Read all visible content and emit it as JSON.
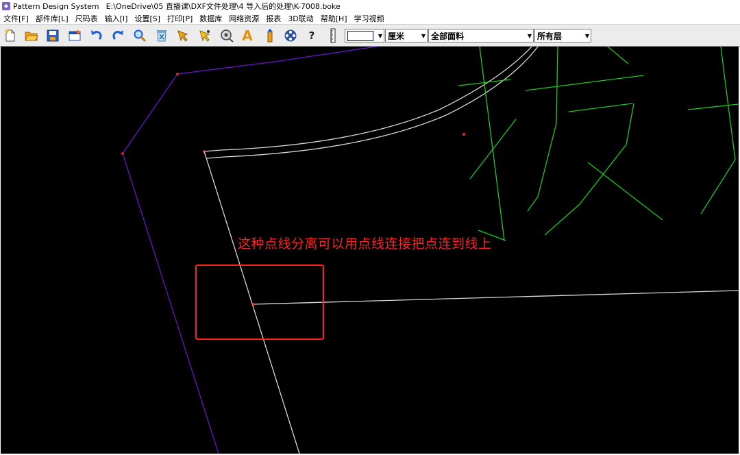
{
  "window": {
    "app_name": "Pattern Design System",
    "file_path": "E:\\OneDrive\\05  直播课\\DXF文件处理\\4 导入后的处理\\K-7008.boke"
  },
  "menu": [
    "文件[F]",
    "部件库[L]",
    "尺码表",
    "输入[I]",
    "设置[S]",
    "打印[P]",
    "数据库",
    "网络资源",
    "报表",
    "3D联动",
    "帮助[H]",
    "学习视频"
  ],
  "toolbar": {
    "icons": [
      "new-file-icon",
      "open-folder-icon",
      "save-icon",
      "import-icon",
      "undo-icon",
      "redo-icon",
      "zoom-icon",
      "delete-icon",
      "select-arrow-icon",
      "point-arrow-icon",
      "tape-icon",
      "text-a-icon",
      "ruler-pin-icon",
      "film-reel-icon",
      "help-icon"
    ],
    "help_label": "?",
    "text_label": "A",
    "unit_value": "厘米",
    "fabric_value": "全部面料",
    "layer_value": "所有层"
  },
  "canvas": {
    "annotation": "这种点线分离可以用点线连接把点连到线上",
    "colors": {
      "background": "#000000",
      "outline_purple": "#6a14c8",
      "outline_white": "#d9d9d9",
      "text_green": "#1ec81e",
      "annotation_red": "#ff2424",
      "point_red": "#ff2020"
    }
  }
}
